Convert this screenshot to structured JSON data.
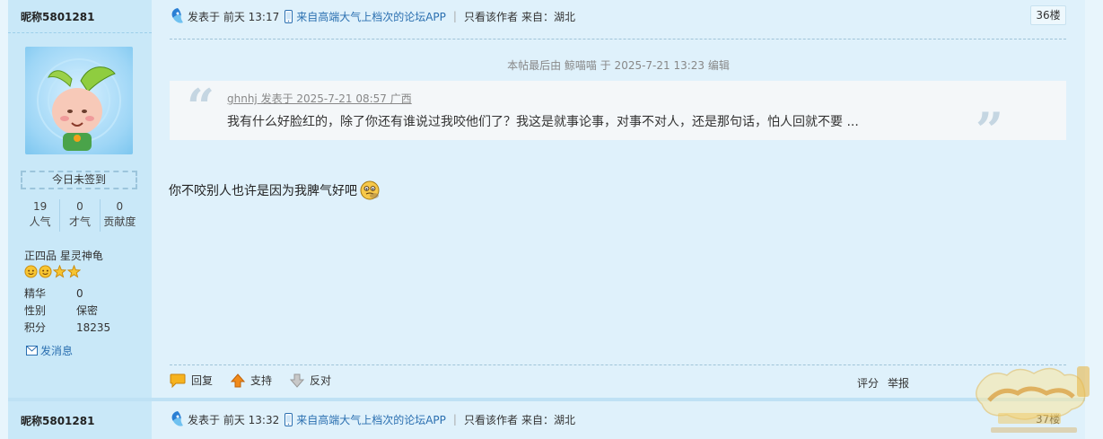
{
  "post1": {
    "user": {
      "nickname": "昵称5801281",
      "signin": "今日未签到",
      "stats": [
        {
          "value": "19",
          "label": "人气"
        },
        {
          "value": "0",
          "label": "才气"
        },
        {
          "value": "0",
          "label": "贡献度"
        }
      ],
      "rank": "正四品 星灵神龟",
      "info": [
        {
          "key": "精华",
          "value": "0"
        },
        {
          "key": "性别",
          "value": "保密"
        },
        {
          "key": "积分",
          "value": "18235"
        }
      ],
      "message": "发消息"
    },
    "header": {
      "posted": "发表于 前天 13:17",
      "app": "来自高端大气上档次的论坛APP",
      "only_author": "只看该作者",
      "from": "来自：湖北",
      "floor": "36楼"
    },
    "edited_note": "本帖最后由 鲸喵喵 于 2025-7-21 13:23 编辑",
    "quote": {
      "meta": "ghnhj 发表于 2025-7-21 08:57 广西",
      "text": "我有什么好脸红的，除了你还有谁说过我咬他们了？我这是就事论事，对事不对人，还是那句话，怕人回就不要 ..."
    },
    "content": "你不咬别人也许是因为我脾气好吧",
    "actions": {
      "reply": "回复",
      "support": "支持",
      "oppose": "反对",
      "rate": "评分",
      "report": "举报"
    }
  },
  "post2": {
    "user": {
      "nickname": "昵称5801281"
    },
    "header": {
      "posted": "发表于 前天 13:32",
      "app": "来自高端大气上档次的论坛APP",
      "only_author": "只看该作者",
      "from": "来自：湖北",
      "floor": "37楼"
    }
  },
  "colors": {
    "link": "#2a6fb0",
    "sidebar_bg": "#c9e8f8",
    "main_bg": "#dff1fb",
    "quote_bg": "#f4f7f9"
  }
}
